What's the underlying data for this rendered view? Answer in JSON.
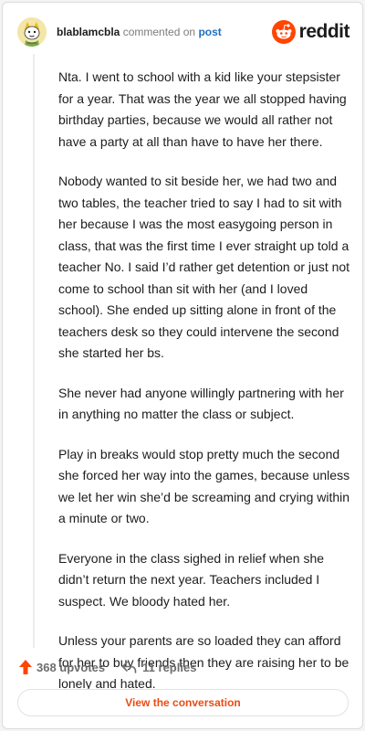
{
  "comment": {
    "username": "blablamcbla",
    "action_text": "commented on",
    "post_link": "post",
    "paragraphs": [
      "Nta. I went to school with a kid like your stepsister for a year. That was the year we all stopped having birthday parties, because we would all rather not have a party at all than have to have her there.",
      "Nobody wanted to sit beside her, we had two and two tables, the teacher tried to say I had to sit with her because I was the most easygoing person in class, that was the first time I ever straight up told a teacher No. I said I’d rather get detention or just not come to school than sit with her (and I loved school). She ended up sitting alone in front of the teachers desk so they could intervene the second she started her bs.",
      "She never had anyone willingly partnering with her in anything no matter the class or subject.",
      "Play in breaks would stop pretty much the second she forced her way into the games, because unless we let her win she’d be screaming and crying within a minute or two.",
      "Everyone in the class sighed in relief when she didn’t return the next year. Teachers included I suspect. We bloody hated her.",
      "Unless your parents are so loaded they can afford for her to buy friends then they are raising her to be lonely and hated."
    ],
    "upvotes": "368 upvotes",
    "replies": "11 replies"
  },
  "brand": {
    "name": "reddit",
    "icon": "reddit-logo-icon",
    "color": "#ff4500"
  },
  "actions": {
    "view_conversation": "View the conversation"
  },
  "colors": {
    "accent": "#ea4b14",
    "post_link": "#1f6fbf",
    "upvote": "#ff4500"
  }
}
